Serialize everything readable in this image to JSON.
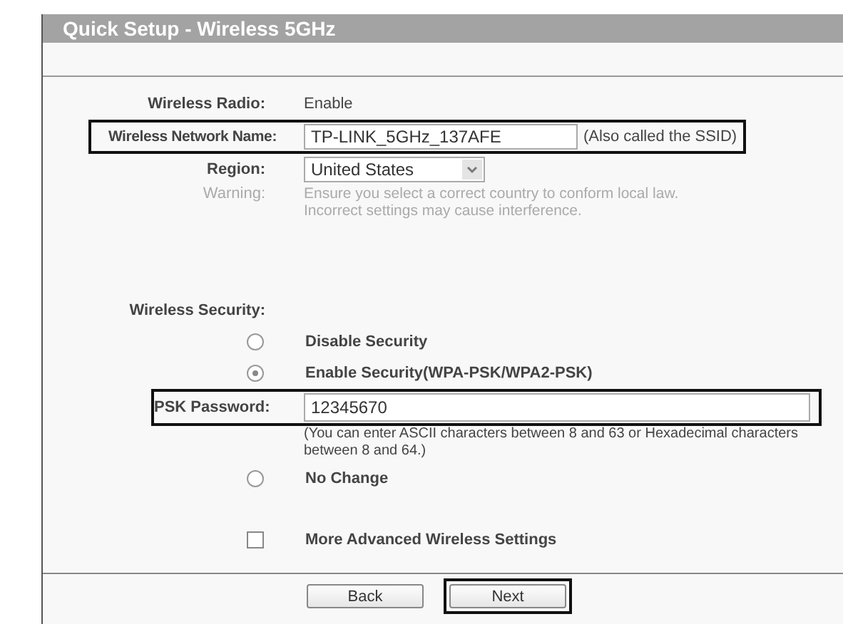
{
  "title": "Quick Setup - Wireless 5GHz",
  "radio": {
    "label": "Wireless Radio:",
    "value": "Enable"
  },
  "network_name": {
    "label": "Wireless Network Name:",
    "value": "TP-LINK_5GHz_137AFE",
    "note": "(Also called the SSID)",
    "highlighted": true
  },
  "region": {
    "label": "Region:",
    "value": "United States"
  },
  "warning": {
    "label": "Warning:",
    "lines": [
      "Ensure you select a correct country to conform local law.",
      "Incorrect settings may cause interference."
    ]
  },
  "security": {
    "label": "Wireless Security:",
    "options": [
      {
        "label": "Disable Security",
        "selected": false
      },
      {
        "label": "Enable Security(WPA-PSK/WPA2-PSK)",
        "selected": true,
        "password": {
          "label": "PSK Password:",
          "value": "12345670",
          "highlighted": true,
          "hint": "(You can enter ASCII characters between 8 and 63 or Hexadecimal characters between 8 and 64.)"
        }
      },
      {
        "label": "No Change",
        "selected": false
      }
    ]
  },
  "advanced": {
    "label": "More Advanced Wireless Settings",
    "checked": false
  },
  "buttons": [
    {
      "label": "Back",
      "highlighted": false
    },
    {
      "label": "Next",
      "highlighted": true
    }
  ]
}
